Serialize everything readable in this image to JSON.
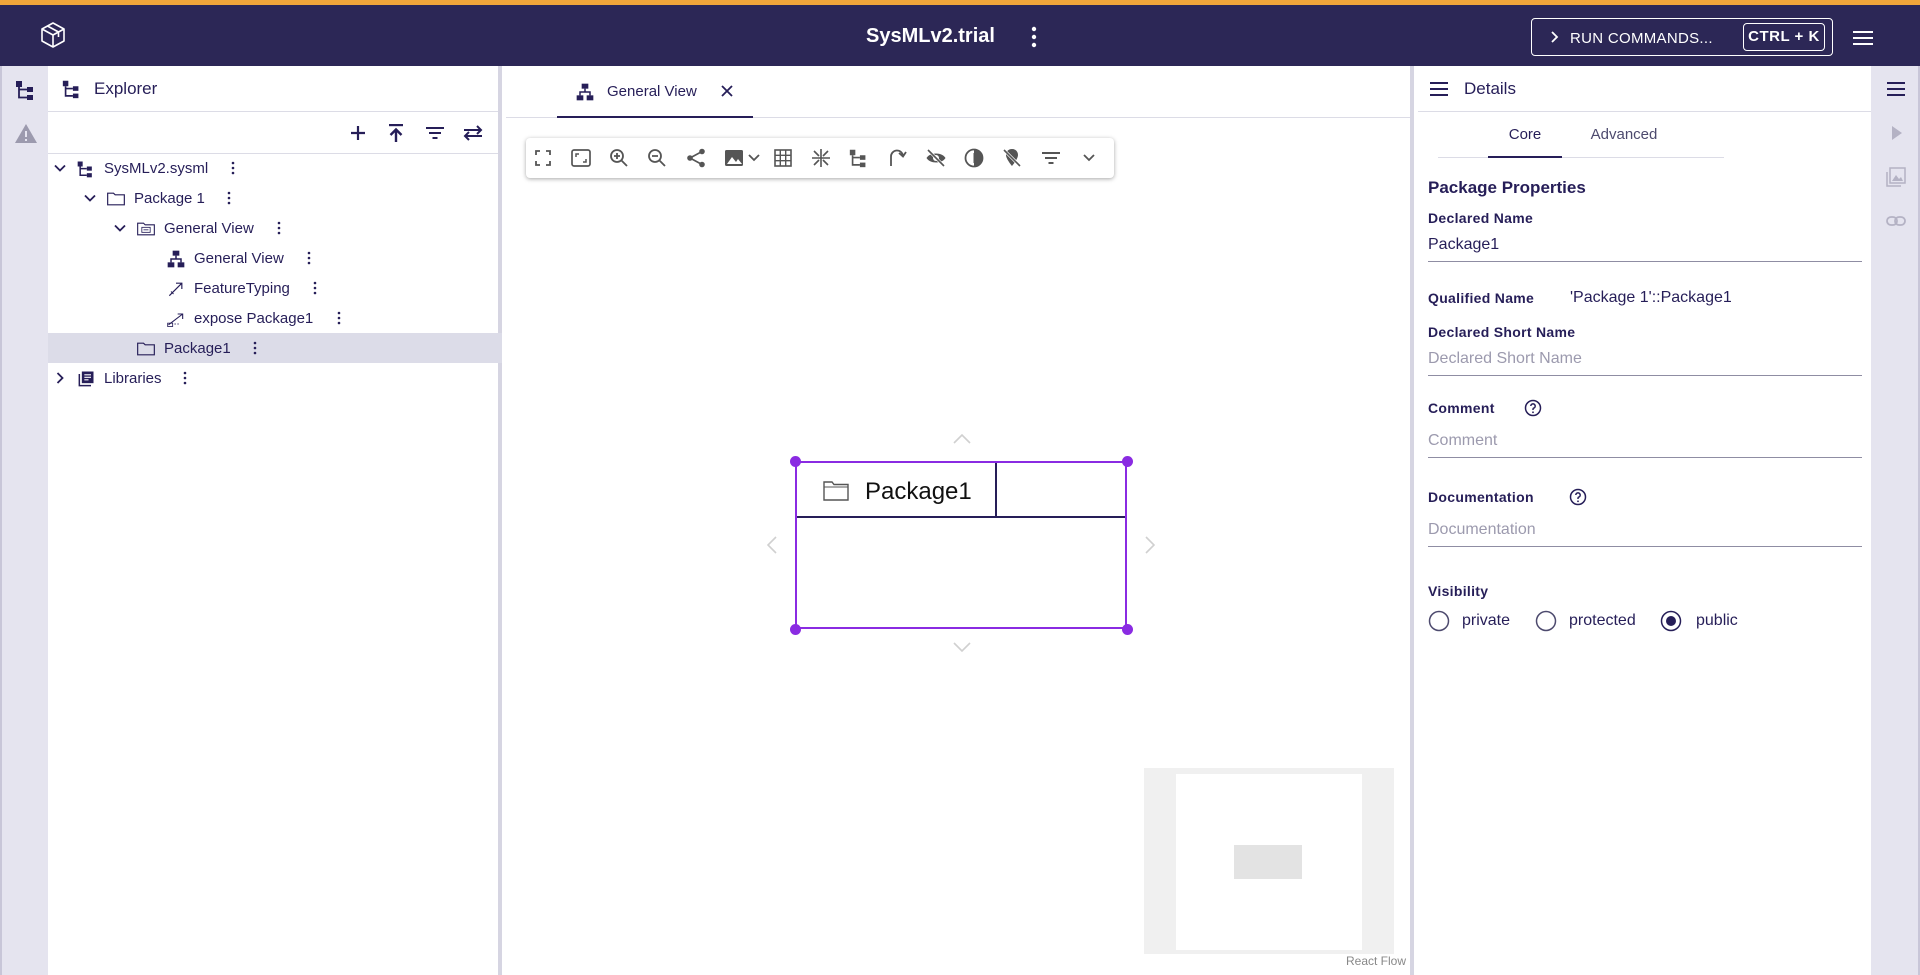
{
  "app": {
    "title": "SysMLv2.trial",
    "run_commands_label": "RUN COMMANDS...",
    "run_commands_shortcut": "CTRL + K",
    "accent_color": "#f0a53a",
    "header_color": "#2c2756"
  },
  "explorer": {
    "title": "Explorer",
    "toolbar": [
      "add-icon",
      "upload-icon",
      "filter-icon",
      "swap-icon"
    ],
    "tree": [
      {
        "label": "SysMLv2.sysml",
        "icon": "model-icon",
        "expanded": true
      },
      {
        "label": "Package 1",
        "icon": "folder-icon",
        "expanded": true
      },
      {
        "label": "General View",
        "icon": "view-icon",
        "expanded": true
      },
      {
        "label": "General View",
        "icon": "diagram-icon"
      },
      {
        "label": "FeatureTyping",
        "icon": "feature-typing-icon"
      },
      {
        "label": "expose Package1",
        "icon": "expose-icon"
      },
      {
        "label": "Package1",
        "icon": "folder-icon",
        "selected": true
      },
      {
        "label": "Libraries",
        "icon": "library-icon",
        "expanded": false
      }
    ]
  },
  "editor": {
    "tab_label": "General View",
    "node_label": "Package1",
    "attribution": "React Flow",
    "selection_color": "#8a2be2"
  },
  "details": {
    "title": "Details",
    "tabs": [
      "Core",
      "Advanced"
    ],
    "active_tab": "Core",
    "section_title": "Package Properties",
    "declared_name_label": "Declared Name",
    "declared_name_value": "Package1",
    "qualified_name_label": "Qualified Name",
    "qualified_name_value": "'Package 1'::Package1",
    "declared_short_name_label": "Declared Short Name",
    "declared_short_name_placeholder": "Declared Short Name",
    "comment_label": "Comment",
    "comment_placeholder": "Comment",
    "documentation_label": "Documentation",
    "documentation_placeholder": "Documentation",
    "visibility_label": "Visibility",
    "visibility_options": [
      "private",
      "protected",
      "public"
    ],
    "visibility_selected": "public"
  }
}
